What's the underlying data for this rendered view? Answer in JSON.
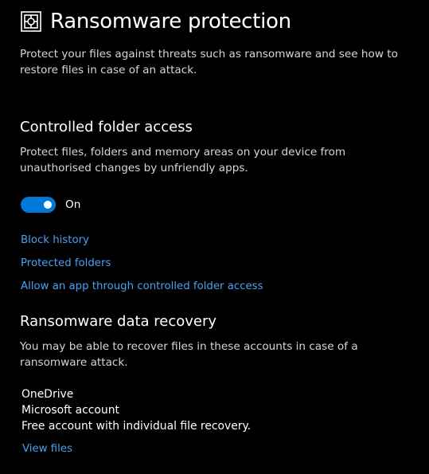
{
  "header": {
    "title": "Ransomware protection",
    "icon": "ransomware-shield-icon",
    "description": "Protect your files against threats such as ransomware and see how to restore files in case of an attack."
  },
  "controlled_folder_access": {
    "title": "Controlled folder access",
    "description": "Protect files, folders and memory areas on your device from unauthorised changes by unfriendly apps.",
    "toggle": {
      "state": "on",
      "label": "On"
    },
    "links": {
      "block_history": "Block history",
      "protected_folders": "Protected folders",
      "allow_app": "Allow an app through controlled folder access"
    }
  },
  "data_recovery": {
    "title": "Ransomware data recovery",
    "description": "You may be able to recover files in these accounts in case of a ransomware attack.",
    "account": {
      "name": "OneDrive",
      "type": "Microsoft account",
      "details": "Free account with individual file recovery."
    },
    "view_files_link": "View files"
  },
  "colors": {
    "background": "#000000",
    "accent": "#0078d7",
    "link": "#4ba0f0",
    "text": "#ffffff",
    "secondary_text": "#d6d6d6"
  }
}
